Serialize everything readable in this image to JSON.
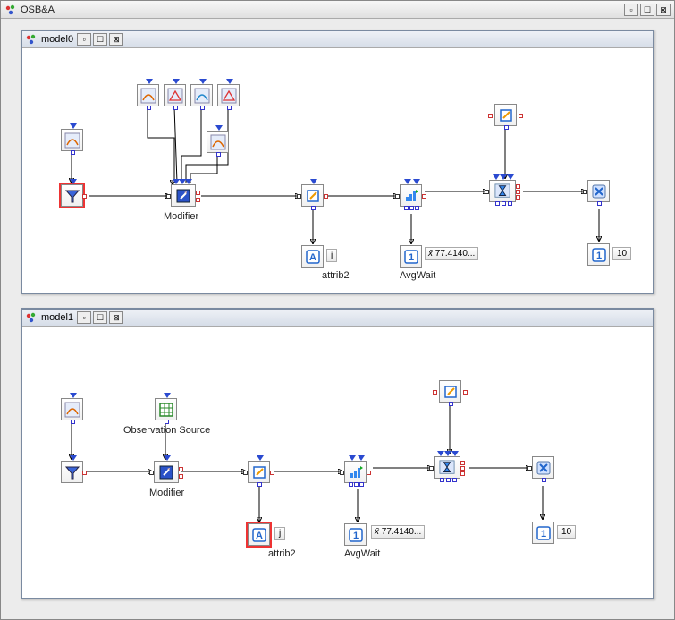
{
  "outer": {
    "title": "OSB&A"
  },
  "model0": {
    "title": "model0",
    "modifier_label": "Modifier",
    "attrib_j": "j",
    "attrib_label": "attrib2",
    "avgwait_label": "AvgWait",
    "avgwait_value": "77.4140...",
    "count_10": "10"
  },
  "model1": {
    "title": "model1",
    "obs_source_label": "Observation Source",
    "modifier_label": "Modifier",
    "attrib_j": "j",
    "attrib_label": "attrib2",
    "avgwait_label": "AvgWait",
    "avgwait_value": "77.4140...",
    "count_10": "10"
  },
  "icons": {
    "xbar": "x̄"
  }
}
